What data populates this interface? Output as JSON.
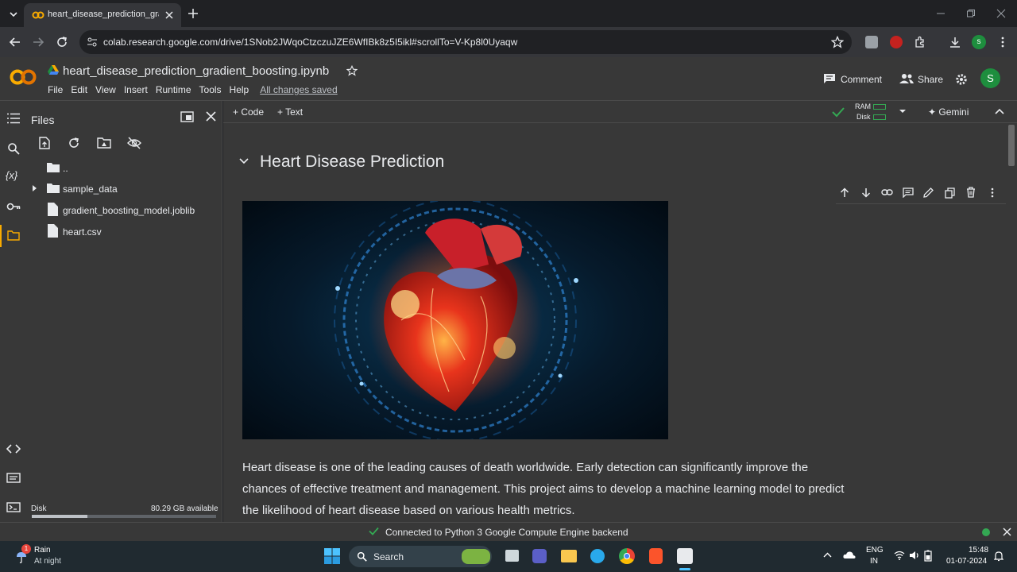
{
  "browser": {
    "tab_title": "heart_disease_prediction_gradie",
    "url": "colab.research.google.com/drive/1SNob2JWqoCtzczuJZE6WfIBk8z5I5ikl#scrollTo=V-Kp8l0Uyaqw",
    "profile_initial": "s"
  },
  "colab": {
    "logo": "CO",
    "notebook_title": "heart_disease_prediction_gradient_boosting.ipynb",
    "menu": [
      "File",
      "Edit",
      "View",
      "Insert",
      "Runtime",
      "Tools",
      "Help"
    ],
    "save_status": "All changes saved",
    "comment_label": "Comment",
    "share_label": "Share",
    "avatar_initial": "S"
  },
  "files_panel": {
    "title": "Files",
    "items": [
      {
        "label": "..",
        "icon": "folder-icon"
      },
      {
        "label": "sample_data",
        "icon": "folder-icon"
      },
      {
        "label": "gradient_boosting_model.joblib",
        "icon": "file-icon"
      },
      {
        "label": "heart.csv",
        "icon": "file-icon"
      }
    ],
    "disk_label": "Disk",
    "disk_available": "80.29 GB available",
    "disk_used_fraction": 0.3
  },
  "cell_toolbar": {
    "code_label": "Code",
    "text_label": "Text",
    "ram_label": "RAM",
    "disk_label": "Disk",
    "gemini_label": "Gemini"
  },
  "notebook": {
    "heading": "Heart Disease Prediction",
    "paragraph_lines": [
      "Heart disease is one of the leading causes of death worldwide. Early detection can significantly improve the",
      "chances of effective treatment and management. This project aims to develop a machine learning model to predict",
      "the likelihood of heart disease based on various health metrics."
    ]
  },
  "status": {
    "message": "Connected to Python 3 Google Compute Engine backend"
  },
  "taskbar": {
    "weather_title": "Rain",
    "weather_sub": "At night",
    "search_label": "Search",
    "lang_top": "ENG",
    "lang_bottom": "IN",
    "time": "15:48",
    "date": "01-07-2024"
  }
}
